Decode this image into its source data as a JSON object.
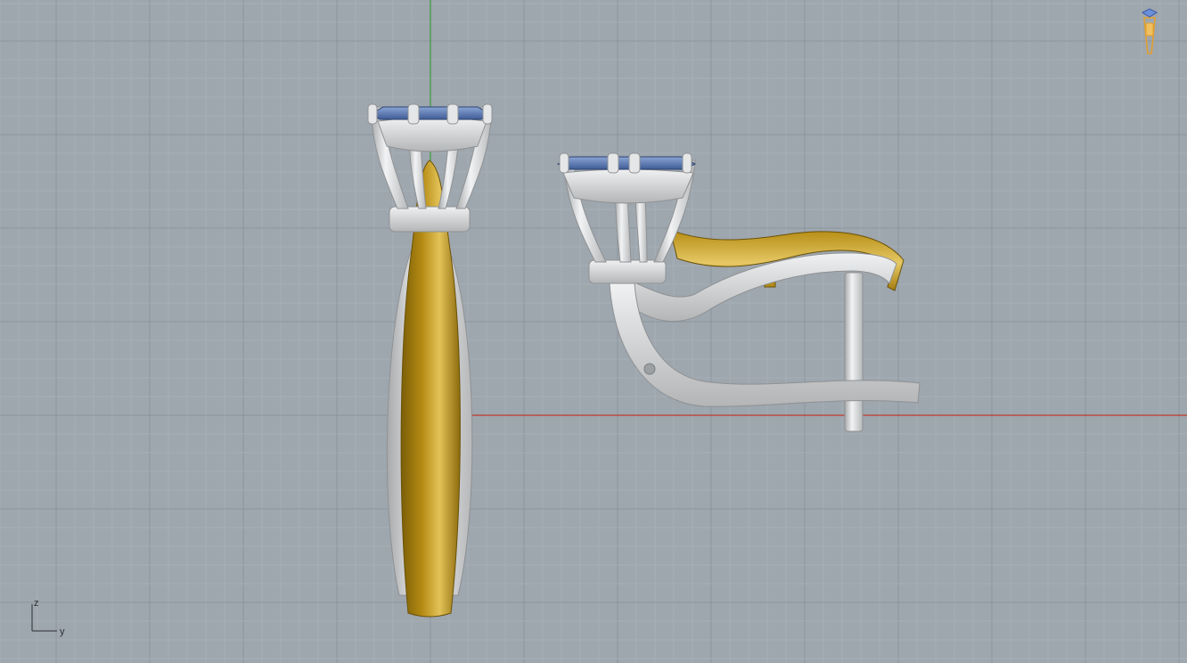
{
  "viewport": {
    "view": "right-side",
    "background_color": "#9ea6ae",
    "grid_minor_color": "#a9b0b7",
    "grid_major_color": "#8c949c",
    "x_axis_color": "#c0392b",
    "y_axis_color": "#3a9d3a",
    "materials": {
      "white_gold": "#d9dbdc",
      "yellow_gold": "#c9a21a",
      "gemstone": "#5876b0"
    }
  },
  "axis_indicator": {
    "z_label": "z",
    "y_label": "y"
  },
  "nav_widget": {
    "icon": "jewelry-ring-navigation-icon",
    "color": "#e0a030"
  }
}
